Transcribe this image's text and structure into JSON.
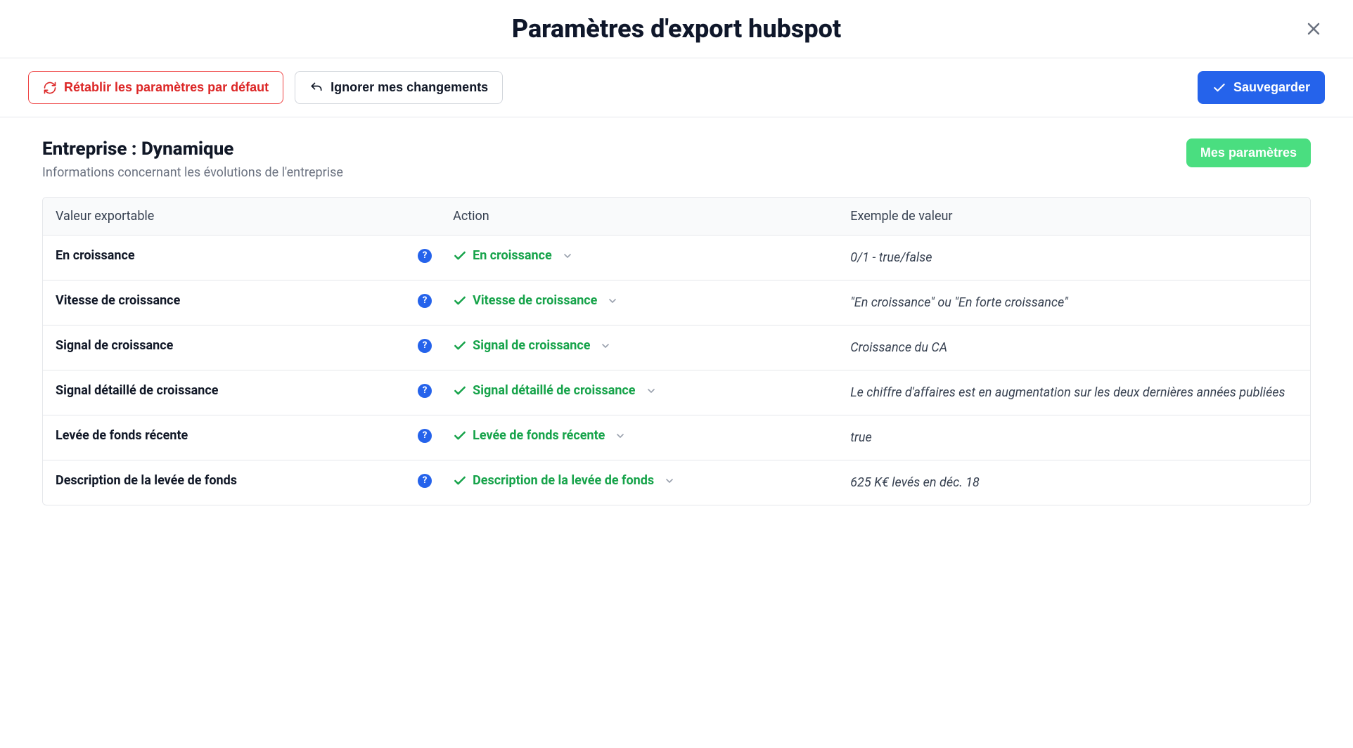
{
  "header": {
    "title": "Paramètres d'export hubspot"
  },
  "toolbar": {
    "reset_label": "Rétablir les paramètres par défaut",
    "ignore_label": "Ignorer mes changements",
    "save_label": "Sauvegarder"
  },
  "section": {
    "title": "Entreprise : Dynamique",
    "subtitle": "Informations concernant les évolutions de l'entreprise",
    "params_button": "Mes paramètres"
  },
  "table": {
    "headers": {
      "name": "Valeur exportable",
      "action": "Action",
      "example": "Exemple de valeur"
    },
    "rows": [
      {
        "name": "En croissance",
        "action": "En croissance",
        "example": "0/1 - true/false"
      },
      {
        "name": "Vitesse de croissance",
        "action": "Vitesse de croissance",
        "example": "\"En croissance\" ou \"En forte croissance\""
      },
      {
        "name": "Signal de croissance",
        "action": "Signal de croissance",
        "example": "Croissance du CA"
      },
      {
        "name": "Signal détaillé de croissance",
        "action": "Signal détaillé de croissance",
        "example": "Le chiffre d'affaires est en augmentation sur les deux dernières années publiées"
      },
      {
        "name": "Levée de fonds récente",
        "action": "Levée de fonds récente",
        "example": "true"
      },
      {
        "name": "Description de la levée de fonds",
        "action": "Description de la levée de fonds",
        "example": "625 K€ levés en déc. 18"
      }
    ]
  }
}
